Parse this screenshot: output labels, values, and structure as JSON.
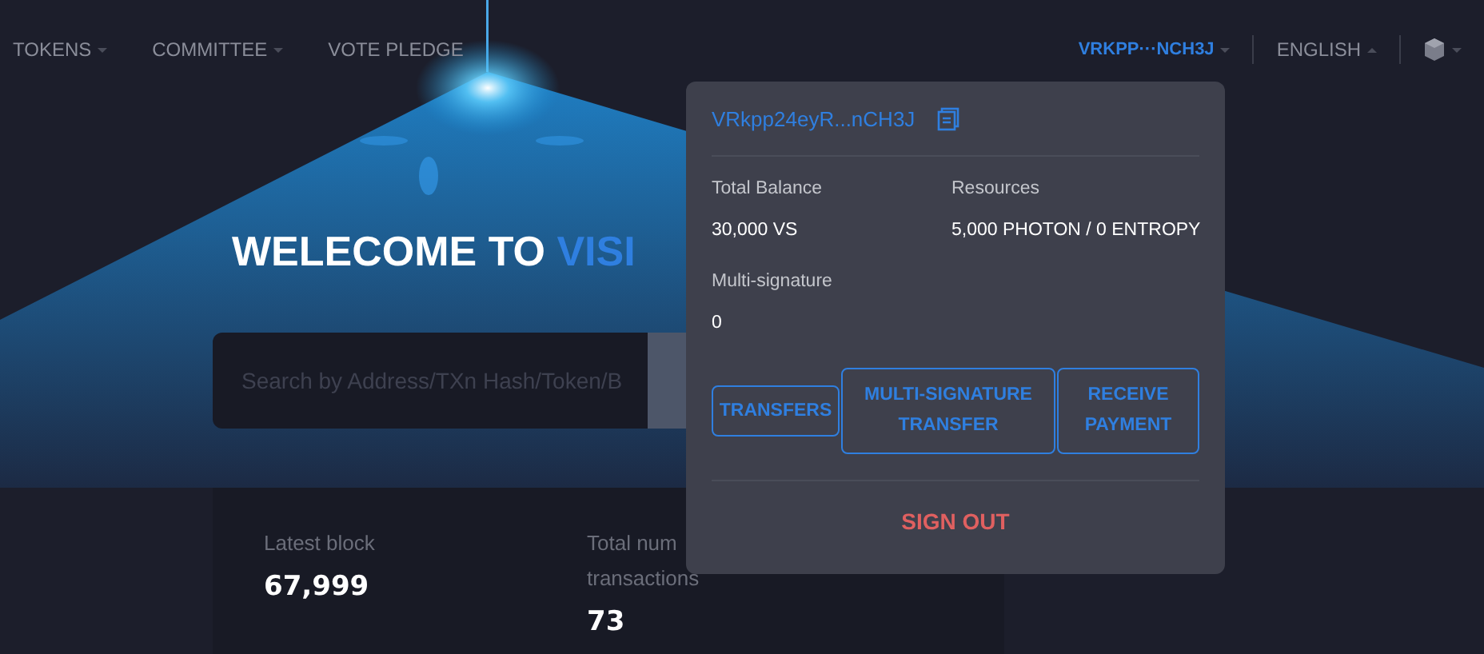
{
  "nav": {
    "items": [
      {
        "label": "TOKENS",
        "dropdown": true
      },
      {
        "label": "COMMITTEE",
        "dropdown": true
      },
      {
        "label": "VOTE PLEDGE",
        "dropdown": false
      }
    ],
    "account": "VRKPP···NCH3J",
    "language": "ENGLISH"
  },
  "hero": {
    "title": "WELECOME TO",
    "title_highlight": "VISI",
    "search": {
      "placeholder": "Search by Address/TXn Hash/Token/B"
    }
  },
  "stats": [
    {
      "label": "Latest block",
      "value": "67,999"
    },
    {
      "label": "Total num transactions",
      "value": "73"
    }
  ],
  "account_menu": {
    "address": "VRkpp24eyR...nCH3J",
    "fields": [
      {
        "label": "Total Balance",
        "value": "30,000 VS"
      },
      {
        "label": "Resources",
        "value": "5,000 PHOTON /  0 ENTROPY"
      },
      {
        "label": "Multi-signature",
        "value": "0"
      }
    ],
    "buttons": [
      "TRANSFERS",
      "MULTI-SIGNATURE TRANSFER",
      "RECEIVE PAYMENT"
    ],
    "sign_out": "SIGN OUT"
  }
}
